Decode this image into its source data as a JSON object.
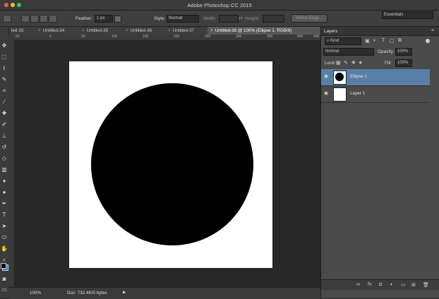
{
  "window": {
    "title": "Adobe Photoshop CC 2015"
  },
  "options": {
    "feather_label": "Feather:",
    "feather_value": "1 px",
    "style_label": "Style:",
    "style_value": "Normal",
    "width_label": "Width:",
    "height_label": "Height:",
    "refine_button": "Refine Edge...",
    "workspace": "Essentials"
  },
  "tabs": [
    {
      "label": "led-33"
    },
    {
      "label": "Untitled-34"
    },
    {
      "label": "Untitled-35"
    },
    {
      "label": "Untitled-36"
    },
    {
      "label": "Untitled-37"
    },
    {
      "label": "Untitled-38 @ 100% (Ellipse 1, RGB/8)"
    }
  ],
  "ruler": {
    "ticks": [
      "50",
      "0",
      "50",
      "100",
      "150",
      "200",
      "250",
      "300",
      "350",
      "400",
      "450"
    ]
  },
  "status": {
    "zoom": "100%",
    "doc": "Doc: 732.4K/0 bytes"
  },
  "panel": {
    "title": "Layers",
    "filter_label": "Kind",
    "blend_mode": "Normal",
    "opacity_label": "Opacity:",
    "opacity_value": "100%",
    "lock_label": "Lock:",
    "fill_label": "Fill:",
    "fill_value": "100%",
    "layers": [
      {
        "name": "Ellipse 1"
      },
      {
        "name": "Layer 1"
      }
    ]
  },
  "colors": {
    "selected_layer": "#5a7fa6",
    "foreground": "#000000",
    "background": "#ffffff"
  }
}
